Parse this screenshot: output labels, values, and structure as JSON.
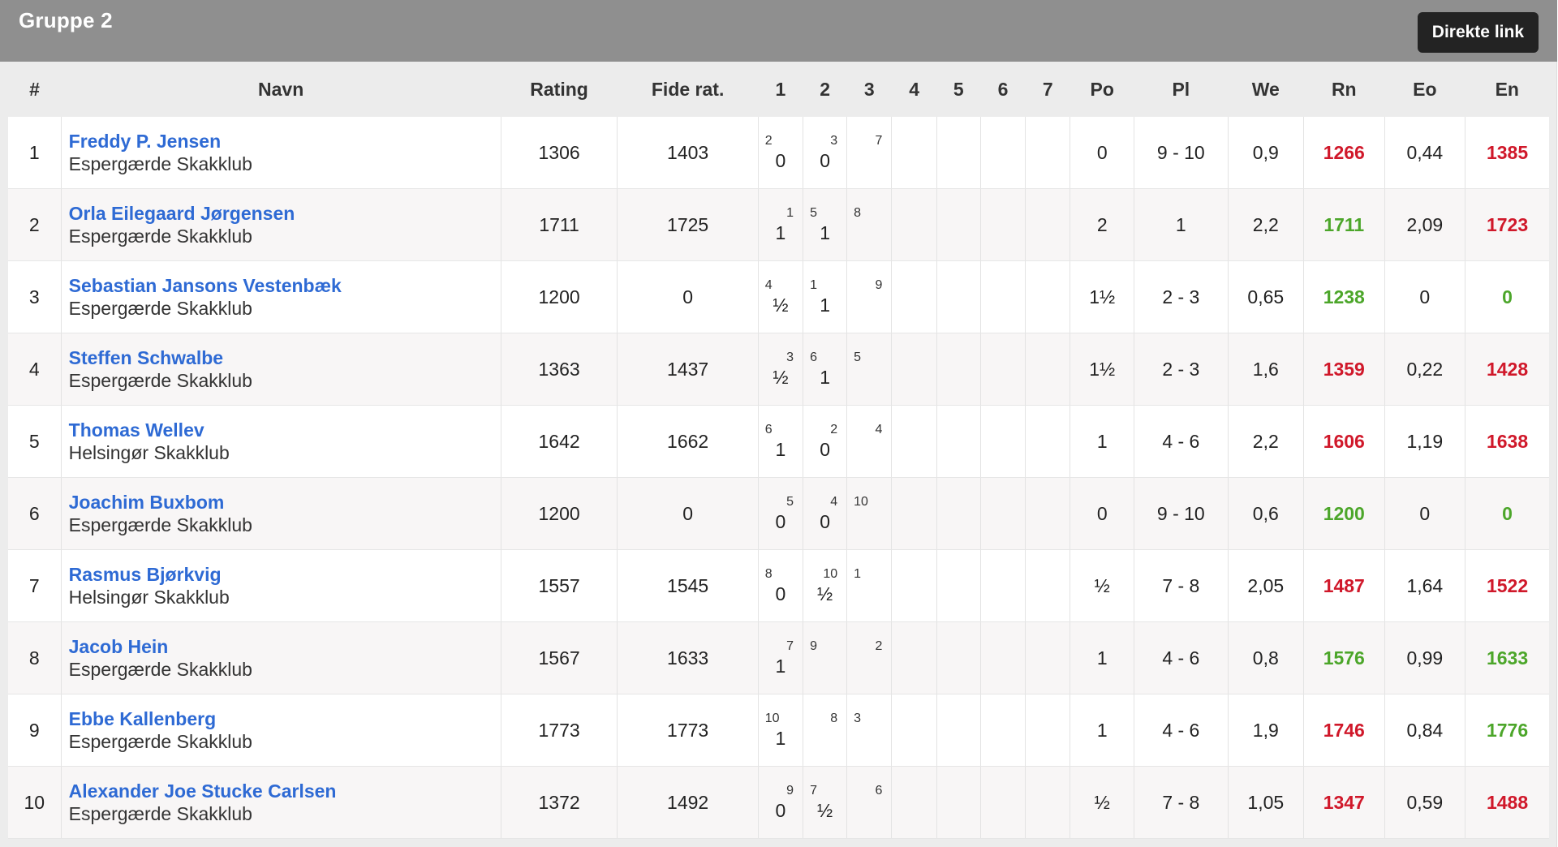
{
  "header": {
    "group_title": "Gruppe 2",
    "direct_link_label": "Direkte link"
  },
  "colors": {
    "red": "#d0182a",
    "green": "#4ca62a",
    "link": "#2e6ad4"
  },
  "columns": [
    "#",
    "Navn",
    "Rating",
    "Fide rat.",
    "1",
    "2",
    "3",
    "4",
    "5",
    "6",
    "7",
    "Po",
    "Pl",
    "We",
    "Rn",
    "Eo",
    "En"
  ],
  "rows": [
    {
      "rank": "1",
      "name": "Freddy P. Jensen",
      "club": "Espergærde Skakklub",
      "rating": "1306",
      "fide": "1403",
      "rounds": [
        {
          "opp": "2",
          "side": "left",
          "res": "0"
        },
        {
          "opp": "3",
          "side": "right",
          "res": "0"
        },
        {
          "opp": "7",
          "side": "right",
          "res": ""
        },
        {
          "opp": "",
          "side": "",
          "res": ""
        },
        {
          "opp": "",
          "side": "",
          "res": ""
        },
        {
          "opp": "",
          "side": "",
          "res": ""
        },
        {
          "opp": "",
          "side": "",
          "res": ""
        }
      ],
      "po": "0",
      "pl": "9 - 10",
      "we": "0,9",
      "rn": "1266",
      "rn_color": "red",
      "eo": "0,44",
      "en": "1385",
      "en_color": "red"
    },
    {
      "rank": "2",
      "name": "Orla Eilegaard Jørgensen",
      "club": "Espergærde Skakklub",
      "rating": "1711",
      "fide": "1725",
      "rounds": [
        {
          "opp": "1",
          "side": "right",
          "res": "1"
        },
        {
          "opp": "5",
          "side": "left",
          "res": "1"
        },
        {
          "opp": "8",
          "side": "left",
          "res": ""
        },
        {
          "opp": "",
          "side": "",
          "res": ""
        },
        {
          "opp": "",
          "side": "",
          "res": ""
        },
        {
          "opp": "",
          "side": "",
          "res": ""
        },
        {
          "opp": "",
          "side": "",
          "res": ""
        }
      ],
      "po": "2",
      "pl": "1",
      "we": "2,2",
      "rn": "1711",
      "rn_color": "green",
      "eo": "2,09",
      "en": "1723",
      "en_color": "red"
    },
    {
      "rank": "3",
      "name": "Sebastian Jansons Vestenbæk",
      "club": "Espergærde Skakklub",
      "rating": "1200",
      "fide": "0",
      "rounds": [
        {
          "opp": "4",
          "side": "left",
          "res": "½"
        },
        {
          "opp": "1",
          "side": "left",
          "res": "1"
        },
        {
          "opp": "9",
          "side": "right",
          "res": ""
        },
        {
          "opp": "",
          "side": "",
          "res": ""
        },
        {
          "opp": "",
          "side": "",
          "res": ""
        },
        {
          "opp": "",
          "side": "",
          "res": ""
        },
        {
          "opp": "",
          "side": "",
          "res": ""
        }
      ],
      "po": "1½",
      "pl": "2 - 3",
      "we": "0,65",
      "rn": "1238",
      "rn_color": "green",
      "eo": "0",
      "en": "0",
      "en_color": "green"
    },
    {
      "rank": "4",
      "name": "Steffen Schwalbe",
      "club": "Espergærde Skakklub",
      "rating": "1363",
      "fide": "1437",
      "rounds": [
        {
          "opp": "3",
          "side": "right",
          "res": "½"
        },
        {
          "opp": "6",
          "side": "left",
          "res": "1"
        },
        {
          "opp": "5",
          "side": "left",
          "res": ""
        },
        {
          "opp": "",
          "side": "",
          "res": ""
        },
        {
          "opp": "",
          "side": "",
          "res": ""
        },
        {
          "opp": "",
          "side": "",
          "res": ""
        },
        {
          "opp": "",
          "side": "",
          "res": ""
        }
      ],
      "po": "1½",
      "pl": "2 - 3",
      "we": "1,6",
      "rn": "1359",
      "rn_color": "red",
      "eo": "0,22",
      "en": "1428",
      "en_color": "red"
    },
    {
      "rank": "5",
      "name": "Thomas Wellev",
      "club": "Helsingør Skakklub",
      "rating": "1642",
      "fide": "1662",
      "rounds": [
        {
          "opp": "6",
          "side": "left",
          "res": "1"
        },
        {
          "opp": "2",
          "side": "right",
          "res": "0"
        },
        {
          "opp": "4",
          "side": "right",
          "res": ""
        },
        {
          "opp": "",
          "side": "",
          "res": ""
        },
        {
          "opp": "",
          "side": "",
          "res": ""
        },
        {
          "opp": "",
          "side": "",
          "res": ""
        },
        {
          "opp": "",
          "side": "",
          "res": ""
        }
      ],
      "po": "1",
      "pl": "4 - 6",
      "we": "2,2",
      "rn": "1606",
      "rn_color": "red",
      "eo": "1,19",
      "en": "1638",
      "en_color": "red"
    },
    {
      "rank": "6",
      "name": "Joachim Buxbom",
      "club": "Espergærde Skakklub",
      "rating": "1200",
      "fide": "0",
      "rounds": [
        {
          "opp": "5",
          "side": "right",
          "res": "0"
        },
        {
          "opp": "4",
          "side": "right",
          "res": "0"
        },
        {
          "opp": "10",
          "side": "left",
          "res": ""
        },
        {
          "opp": "",
          "side": "",
          "res": ""
        },
        {
          "opp": "",
          "side": "",
          "res": ""
        },
        {
          "opp": "",
          "side": "",
          "res": ""
        },
        {
          "opp": "",
          "side": "",
          "res": ""
        }
      ],
      "po": "0",
      "pl": "9 - 10",
      "we": "0,6",
      "rn": "1200",
      "rn_color": "green",
      "eo": "0",
      "en": "0",
      "en_color": "green"
    },
    {
      "rank": "7",
      "name": "Rasmus Bjørkvig",
      "club": "Helsingør Skakklub",
      "rating": "1557",
      "fide": "1545",
      "rounds": [
        {
          "opp": "8",
          "side": "left",
          "res": "0"
        },
        {
          "opp": "10",
          "side": "right",
          "res": "½"
        },
        {
          "opp": "1",
          "side": "left",
          "res": ""
        },
        {
          "opp": "",
          "side": "",
          "res": ""
        },
        {
          "opp": "",
          "side": "",
          "res": ""
        },
        {
          "opp": "",
          "side": "",
          "res": ""
        },
        {
          "opp": "",
          "side": "",
          "res": ""
        }
      ],
      "po": "½",
      "pl": "7 - 8",
      "we": "2,05",
      "rn": "1487",
      "rn_color": "red",
      "eo": "1,64",
      "en": "1522",
      "en_color": "red"
    },
    {
      "rank": "8",
      "name": "Jacob Hein",
      "club": "Espergærde Skakklub",
      "rating": "1567",
      "fide": "1633",
      "rounds": [
        {
          "opp": "7",
          "side": "right",
          "res": "1"
        },
        {
          "opp": "9",
          "side": "left",
          "res": ""
        },
        {
          "opp": "2",
          "side": "right",
          "res": ""
        },
        {
          "opp": "",
          "side": "",
          "res": ""
        },
        {
          "opp": "",
          "side": "",
          "res": ""
        },
        {
          "opp": "",
          "side": "",
          "res": ""
        },
        {
          "opp": "",
          "side": "",
          "res": ""
        }
      ],
      "po": "1",
      "pl": "4 - 6",
      "we": "0,8",
      "rn": "1576",
      "rn_color": "green",
      "eo": "0,99",
      "en": "1633",
      "en_color": "green"
    },
    {
      "rank": "9",
      "name": "Ebbe Kallenberg",
      "club": "Espergærde Skakklub",
      "rating": "1773",
      "fide": "1773",
      "rounds": [
        {
          "opp": "10",
          "side": "left",
          "res": "1"
        },
        {
          "opp": "8",
          "side": "right",
          "res": ""
        },
        {
          "opp": "3",
          "side": "left",
          "res": ""
        },
        {
          "opp": "",
          "side": "",
          "res": ""
        },
        {
          "opp": "",
          "side": "",
          "res": ""
        },
        {
          "opp": "",
          "side": "",
          "res": ""
        },
        {
          "opp": "",
          "side": "",
          "res": ""
        }
      ],
      "po": "1",
      "pl": "4 - 6",
      "we": "1,9",
      "rn": "1746",
      "rn_color": "red",
      "eo": "0,84",
      "en": "1776",
      "en_color": "green"
    },
    {
      "rank": "10",
      "name": "Alexander Joe Stucke Carlsen",
      "club": "Espergærde Skakklub",
      "rating": "1372",
      "fide": "1492",
      "rounds": [
        {
          "opp": "9",
          "side": "right",
          "res": "0"
        },
        {
          "opp": "7",
          "side": "left",
          "res": "½"
        },
        {
          "opp": "6",
          "side": "right",
          "res": ""
        },
        {
          "opp": "",
          "side": "",
          "res": ""
        },
        {
          "opp": "",
          "side": "",
          "res": ""
        },
        {
          "opp": "",
          "side": "",
          "res": ""
        },
        {
          "opp": "",
          "side": "",
          "res": ""
        }
      ],
      "po": "½",
      "pl": "7 - 8",
      "we": "1,05",
      "rn": "1347",
      "rn_color": "red",
      "eo": "0,59",
      "en": "1488",
      "en_color": "red"
    }
  ]
}
